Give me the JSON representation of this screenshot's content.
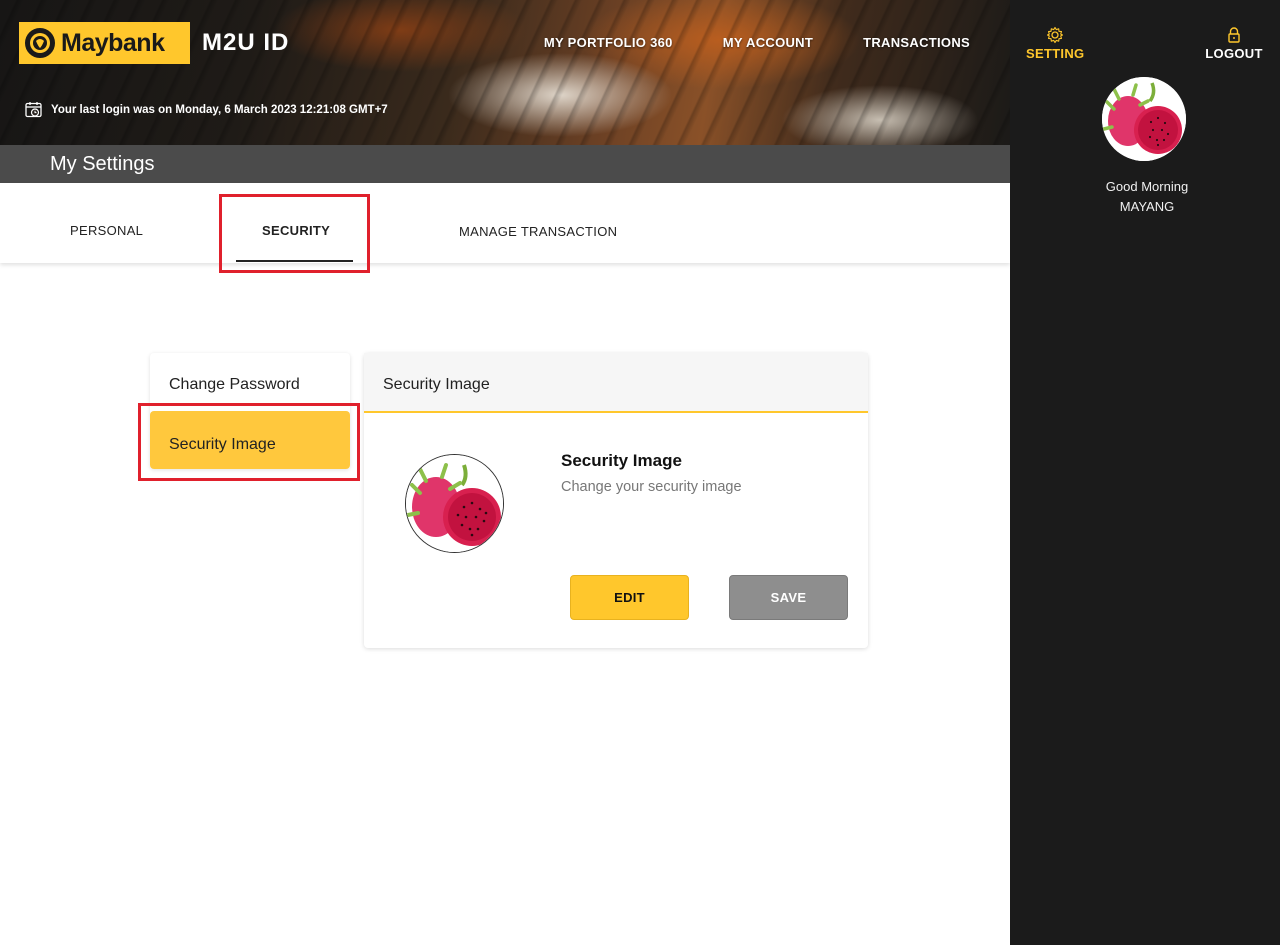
{
  "brand": {
    "logo_text": "Maybank",
    "app_name": "M2U ID"
  },
  "top_nav": {
    "items": [
      "MY PORTFOLIO 360",
      "MY ACCOUNT",
      "TRANSACTIONS"
    ]
  },
  "last_login": {
    "text": "Your last login was on Monday, 6 March 2023 12:21:08 GMT+7"
  },
  "page": {
    "title": "My Settings"
  },
  "tabs": [
    {
      "label": "PERSONAL"
    },
    {
      "label": "SECURITY",
      "active": true
    },
    {
      "label": "MANAGE TRANSACTION"
    }
  ],
  "side_menu": {
    "items": [
      {
        "label": "Change Password"
      },
      {
        "label": "Security Image",
        "active": true
      }
    ]
  },
  "card": {
    "header": "Security Image",
    "title": "Security Image",
    "subtitle": "Change your security image",
    "edit_label": "EDIT",
    "save_label": "SAVE"
  },
  "right_sidebar": {
    "setting_label": "SETTING",
    "logout_label": "LOGOUT",
    "greeting": "Good Morning",
    "user_name": "MAYANG"
  },
  "colors": {
    "accent": "#ffc72c",
    "sidebar": "#1b1b1b",
    "settings_bar": "#4b4b4b",
    "highlight": "#e0202c"
  }
}
